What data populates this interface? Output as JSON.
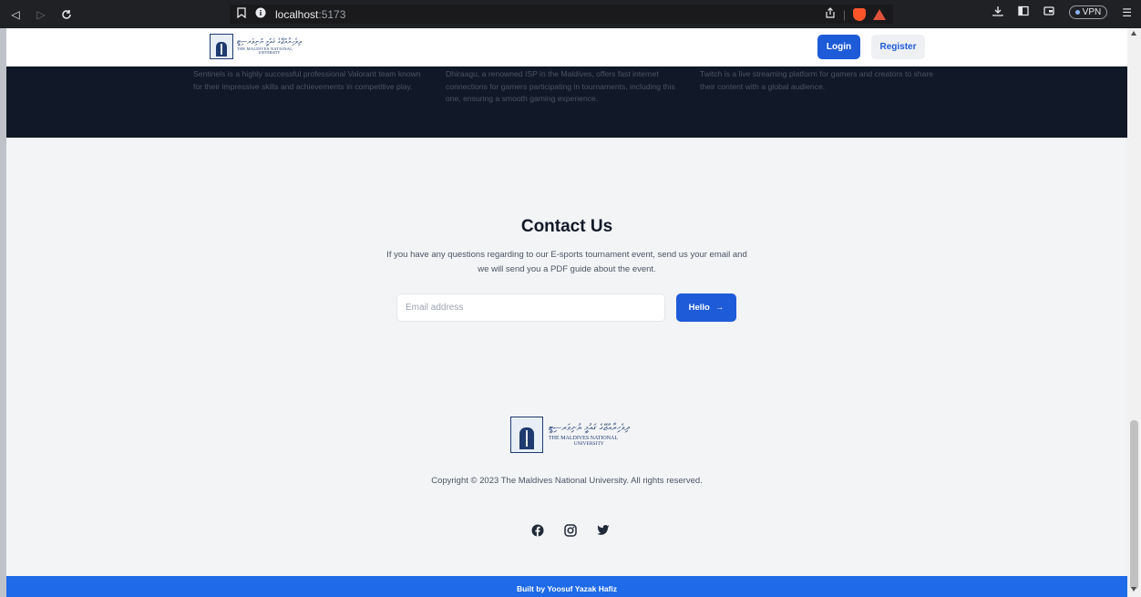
{
  "browser": {
    "url_host": "localhost",
    "url_port": ":5173",
    "vpn_label": "VPN"
  },
  "header": {
    "logo_dhivehi": "ދިވެހިރާއްޖޭގެ ޤައުމީ ޔުނިވަރސިޓީ",
    "logo_en_line1": "THE MALDIVES NATIONAL",
    "logo_en_line2": "UNIVERSITY",
    "login_label": "Login",
    "register_label": "Register"
  },
  "sponsors": [
    {
      "text": "Sentinels is a highly successful professional Valorant team known for their impressive skills and achievements in competitive play."
    },
    {
      "text": "Dhiraagu, a renowned ISP in the Maldives, offers fast internet connections for gamers participating in tournaments, including this one, ensuring a smooth gaming experience."
    },
    {
      "text": "Twitch is a live streaming platform for gamers and creators to share their content with a global audience."
    }
  ],
  "contact": {
    "title": "Contact Us",
    "description": "If you have any questions regarding to our E-sports tournament event, send us your email and we will send you a PDF guide about the event.",
    "email_placeholder": "Email address",
    "button_label": "Hello",
    "button_arrow": "→"
  },
  "footer": {
    "logo_dhivehi": "ދިވެހިރާއްޖޭގެ ޤައުމީ ޔުނިވަރސިޓީ",
    "logo_en_line1": "THE MALDIVES NATIONAL",
    "logo_en_line2": "UNIVERSITY",
    "copyright": "Copyright © 2023 The Maldives National University. All rights reserved.",
    "social": [
      "facebook-icon",
      "instagram-icon",
      "twitter-icon"
    ]
  },
  "bottom_bar": {
    "text": "Built by Yoosuf Yazak Hafiz"
  },
  "colors": {
    "primary": "#1e5bd8",
    "dark_section": "#111827",
    "bottom_bar": "#1e6ae8"
  }
}
